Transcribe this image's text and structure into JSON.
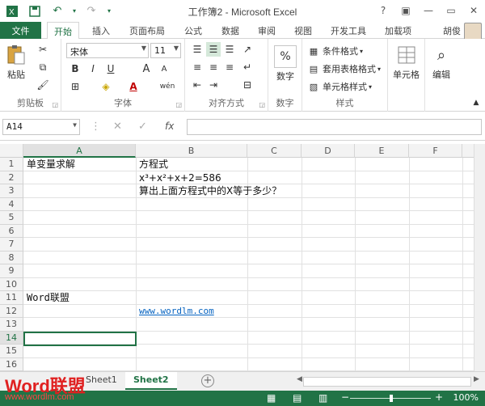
{
  "window": {
    "title": "工作簿2 - Microsoft Excel",
    "minimize": "—",
    "restore": "▭",
    "close": "✕",
    "help": "?",
    "ribbon_display": "▣"
  },
  "ribbon_tabs": {
    "file": "文件",
    "home": "开始",
    "insert": "插入",
    "page_layout": "页面布局",
    "formulas": "公式",
    "data": "数据",
    "review": "审阅",
    "view": "视图",
    "developer": "开发工具",
    "addins": "加载项",
    "user": "胡俊"
  },
  "ribbon": {
    "clipboard": {
      "label": "剪贴板",
      "paste": "粘贴"
    },
    "font": {
      "label": "字体",
      "name": "宋体",
      "size": "11",
      "bold": "B",
      "italic": "I",
      "underline": "U",
      "grow": "A",
      "shrink": "A",
      "phonetic": "wén"
    },
    "alignment": {
      "label": "对齐方式"
    },
    "number": {
      "label": "数字",
      "button": "数字",
      "percent": "%"
    },
    "styles": {
      "label": "样式",
      "conditional": "条件格式",
      "table": "套用表格格式",
      "cell_styles": "单元格样式"
    },
    "cells": {
      "button": "单元格"
    },
    "editing": {
      "button": "编辑"
    }
  },
  "formula_bar": {
    "namebox": "A14",
    "cancel": "✕",
    "enter": "✓",
    "fx": "fx",
    "value": ""
  },
  "columns": [
    "A",
    "B",
    "C",
    "D",
    "E",
    "F"
  ],
  "rows": [
    "1",
    "2",
    "3",
    "4",
    "5",
    "6",
    "7",
    "8",
    "9",
    "10",
    "11",
    "12",
    "13",
    "14",
    "15",
    "16"
  ],
  "cells": {
    "A1": "单变量求解",
    "B1": "方程式",
    "B2": "x³+x²+x+2=586",
    "B3": "算出上面方程式中的X等于多少？",
    "A11": "Word联盟",
    "B12": "www.wordlm.com"
  },
  "sheets": {
    "sheet1": "Sheet1",
    "sheet2": "Sheet2",
    "add": "+"
  },
  "status": {
    "zoom": "100%"
  },
  "watermark": {
    "logo": "Word联盟",
    "url": "www.wordlm.com"
  },
  "colors": {
    "accent": "#217346",
    "link": "#0563c1"
  }
}
